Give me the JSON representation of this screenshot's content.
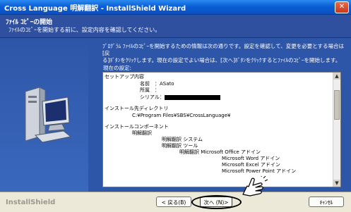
{
  "window": {
    "title": "Cross Language 明解翻訳 - InstallShield Wizard",
    "close_glyph": "✕"
  },
  "header": {
    "title": "ﾌｧｲﾙ ｺﾋﾟｰの開始",
    "subtitle": "ﾌｧｲﾙのｺﾋﾟｰを開始する前に、設定内容を確認してください。"
  },
  "intro": {
    "line1": "ﾌﾟﾛｸﾞﾗﾑ ﾌｧｲﾙのｺﾋﾟｰを開始するための情報は次の通りです。設定を確認して、変更を必要とする場合は[戻",
    "line2": "る]ﾎﾞﾀﾝをｸﾘｯｸします。現在の設定でよい場合は、[次へ]ﾎﾞﾀﾝをｸﾘｯｸするとﾌｧｲﾙのｺﾋﾟｰを開始します。"
  },
  "settings_label": "現在の設定:",
  "summary": {
    "setup_header": "セットアップ内容",
    "name_label": "名前　：ASato",
    "org_label": "所属　：",
    "serial_label": "シリアル：",
    "dest_header": "インストール先ディレクトリ",
    "dest_path": "C:¥Program Files¥SBS¥CrossLanguage¥",
    "comp_header": "インストールコンポーネント",
    "comp_root": "明解翻訳",
    "comp_system": "明解翻訳 システム",
    "comp_tools": "明解翻訳 ツール",
    "comp_office": "明解翻訳 Microsoft Office アドイン",
    "comp_word": "Microsoft Word アドイン",
    "comp_excel": "Microsoft Excel アドイン",
    "comp_ppt": "Microsoft Power Point アドイン"
  },
  "footer": {
    "brand": "InstallShield",
    "back": "< 戻る(B)",
    "next": "次へ (N)>",
    "cancel": "ｷｬﾝｾﾙ"
  },
  "scrollbar": {
    "up_glyph": "▲",
    "down_glyph": "▼"
  },
  "colors": {
    "header_blue": "#2f4f9f",
    "body_blue": "#2e56a8",
    "titlebar_blue": "#0a5fd6"
  },
  "icons": [
    "computer-icon",
    "pointing-hand-icon",
    "close-icon"
  ]
}
